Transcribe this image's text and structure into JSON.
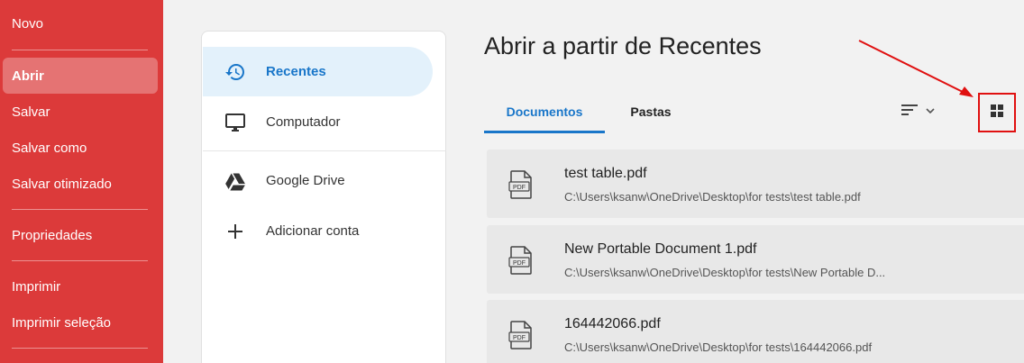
{
  "menu": {
    "items": [
      {
        "label": "Novo",
        "active": false
      },
      {
        "label": "Abrir",
        "active": true
      },
      {
        "label": "Salvar",
        "active": false
      },
      {
        "label": "Salvar como",
        "active": false
      },
      {
        "label": "Salvar otimizado",
        "active": false
      },
      {
        "label": "Propriedades",
        "active": false
      },
      {
        "label": "Imprimir",
        "active": false
      },
      {
        "label": "Imprimir seleção",
        "active": false
      }
    ]
  },
  "locations": {
    "items": [
      {
        "label": "Recentes",
        "icon": "history-icon",
        "active": true
      },
      {
        "label": "Computador",
        "icon": "monitor-icon",
        "active": false
      },
      {
        "label": "Google Drive",
        "icon": "google-drive-icon",
        "active": false
      },
      {
        "label": "Adicionar conta",
        "icon": "plus-icon",
        "active": false
      }
    ]
  },
  "main": {
    "title": "Abrir a partir de Recentes",
    "tabs": [
      {
        "label": "Documentos",
        "active": true
      },
      {
        "label": "Pastas",
        "active": false
      }
    ],
    "files": [
      {
        "name": "test table.pdf",
        "path": "C:\\Users\\ksanw\\OneDrive\\Desktop\\for tests\\test table.pdf",
        "badge": "PDF"
      },
      {
        "name": "New Portable Document 1.pdf",
        "path": "C:\\Users\\ksanw\\OneDrive\\Desktop\\for tests\\New Portable D...",
        "badge": "PDF"
      },
      {
        "name": "164442066.pdf",
        "path": "C:\\Users\\ksanw\\OneDrive\\Desktop\\for tests\\164442066.pdf",
        "badge": "PDF"
      }
    ]
  },
  "colors": {
    "menu_bg": "#dc3a3a",
    "accent": "#1976c9",
    "highlight": "#e01010"
  }
}
